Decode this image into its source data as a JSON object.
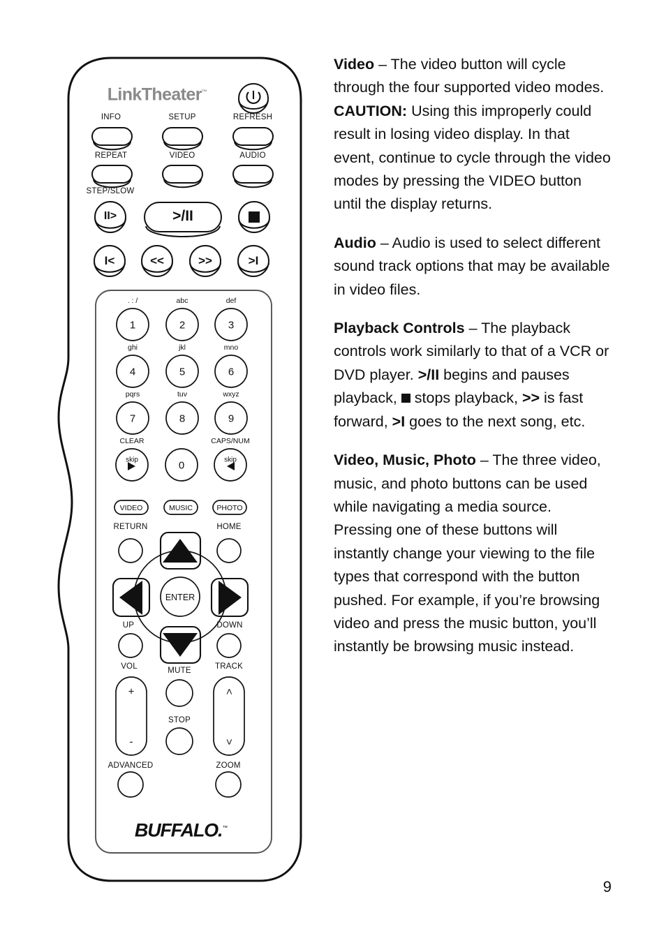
{
  "document": {
    "page_number": "9"
  },
  "remote": {
    "brand_logo": "LinkTheater",
    "brand_logo_tm": "™",
    "footer_logo": "BUFFALO",
    "footer_logo_tm": "™",
    "power_icon": "power-icon",
    "top_labels": {
      "info": "INFO",
      "setup": "SETUP",
      "refresh": "REFRESH",
      "repeat": "REPEAT",
      "video": "VIDEO",
      "audio": "AUDIO",
      "step_slow": "STEP/SLOW"
    },
    "transport": {
      "step_slow": "II>",
      "play_pause": ">/II",
      "stop": "stop-square-icon",
      "prev": "I<",
      "rewind": "<<",
      "fast_forward": ">>",
      "next": ">I"
    },
    "keypad": [
      {
        "hint": ". : /",
        "digit": "1"
      },
      {
        "hint": "abc",
        "digit": "2"
      },
      {
        "hint": "def",
        "digit": "3"
      },
      {
        "hint": "ghi",
        "digit": "4"
      },
      {
        "hint": "jkl",
        "digit": "5"
      },
      {
        "hint": "mno",
        "digit": "6"
      },
      {
        "hint": "pqrs",
        "digit": "7"
      },
      {
        "hint": "tuv",
        "digit": "8"
      },
      {
        "hint": "wxyz",
        "digit": "9"
      }
    ],
    "keypad_bottom": {
      "clear_label": "CLEAR",
      "capsnum_label": "CAPS/NUM",
      "skip_back": "skip",
      "zero": "0",
      "skip_fwd": "skip"
    },
    "media_pills": {
      "video": "VIDEO",
      "music": "MUSIC",
      "photo": "PHOTO"
    },
    "nav": {
      "return_label": "RETURN",
      "home_label": "HOME",
      "enter_label": "ENTER",
      "up_label": "UP",
      "down_label": "DOWN",
      "vol_label": "VOL",
      "mute_label": "MUTE",
      "track_label": "TRACK",
      "stop_label": "STOP",
      "advanced_label": "ADVANCED",
      "zoom_label": "ZOOM",
      "vol_plus": "+",
      "vol_minus": "-",
      "track_prev": "<",
      "track_next": ">"
    }
  },
  "content": {
    "p1": {
      "title": "Video",
      "dash": " – ",
      "t1": "The video button will cycle through the four supported video modes.  ",
      "caution": "CAUTION:",
      "t2": " Using this improperly could result in losing video display.  In that event, continue to cycle through the video modes by pressing the VIDEO button until the display returns."
    },
    "p2": {
      "title": "Audio",
      "dash": " – ",
      "body": "Audio is used to select different sound track options that may be available in video files."
    },
    "p3": {
      "title": "Playback Controls",
      "dash": " – ",
      "t1": "The playback controls work similarly to that of a VCR or DVD player.  ",
      "sym_play": ">/II",
      "t2": " begins and pauses playback,  ",
      "sym_stop": "stop-square-icon",
      "t3": " stops playback,  ",
      "sym_ff": ">>",
      "t4": " is fast forward,  ",
      "sym_next": ">I",
      "t5": " goes to the next song, etc."
    },
    "p4": {
      "title": "Video, Music, Photo",
      "dash": " – ",
      "body": "The three video, music, and photo buttons can be used while navigating a media source.  Pressing one of these buttons will instantly change your viewing to the file types that correspond with the button pushed.  For example, if you’re browsing video and press the music button, you’ll instantly be browsing music instead."
    }
  }
}
